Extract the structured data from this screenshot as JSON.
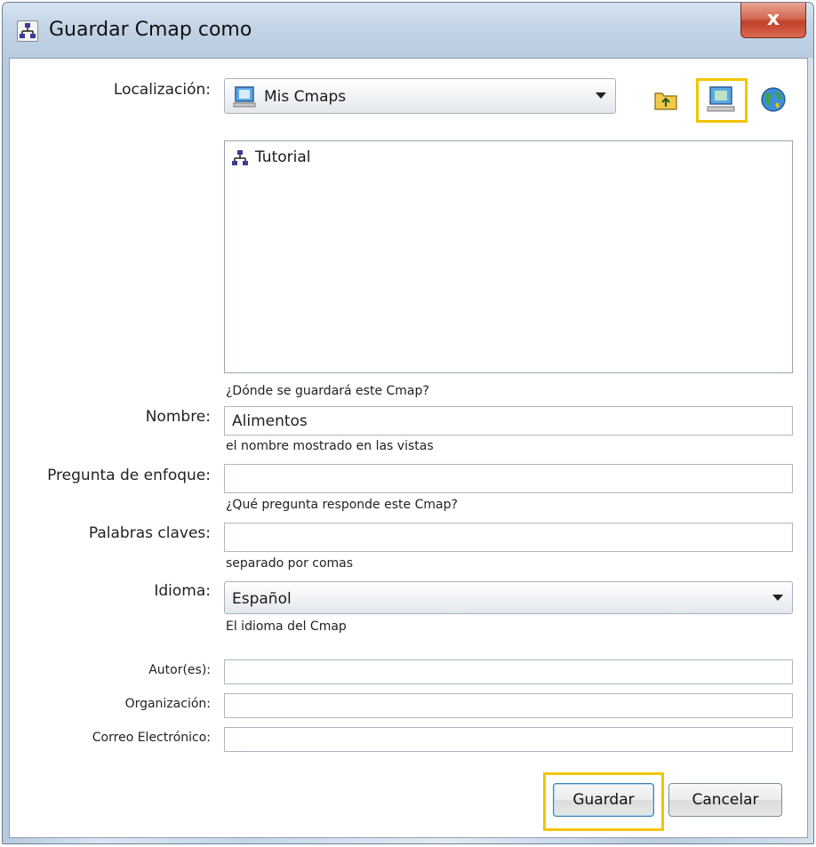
{
  "window": {
    "title": "Guardar Cmap como",
    "close_label": "x"
  },
  "location": {
    "label": "Localización:",
    "value": "Mis Cmaps",
    "list_items": [
      "Tutorial"
    ],
    "hint": "¿Dónde se guardará este Cmap?"
  },
  "name": {
    "label": "Nombre:",
    "value": "Alimentos",
    "hint": "el nombre mostrado en las vistas"
  },
  "focus_question": {
    "label": "Pregunta de enfoque:",
    "value": "",
    "hint": "¿Qué pregunta responde este Cmap?"
  },
  "keywords": {
    "label": "Palabras claves:",
    "value": "",
    "hint": "separado por comas"
  },
  "language": {
    "label": "Idioma:",
    "value": "Español",
    "hint": "El idioma del Cmap"
  },
  "authors": {
    "label": "Autor(es):",
    "value": ""
  },
  "organization": {
    "label": "Organización:",
    "value": ""
  },
  "email": {
    "label": "Correo Electrónico:",
    "value": ""
  },
  "buttons": {
    "save": "Guardar",
    "cancel": "Cancelar"
  },
  "toolbar_icons": [
    "folder-up-icon",
    "my-cmaps-computer-icon",
    "globe-places-icon"
  ],
  "colors": {
    "highlight": "#f2c500",
    "accent": "#3c7fb1"
  }
}
